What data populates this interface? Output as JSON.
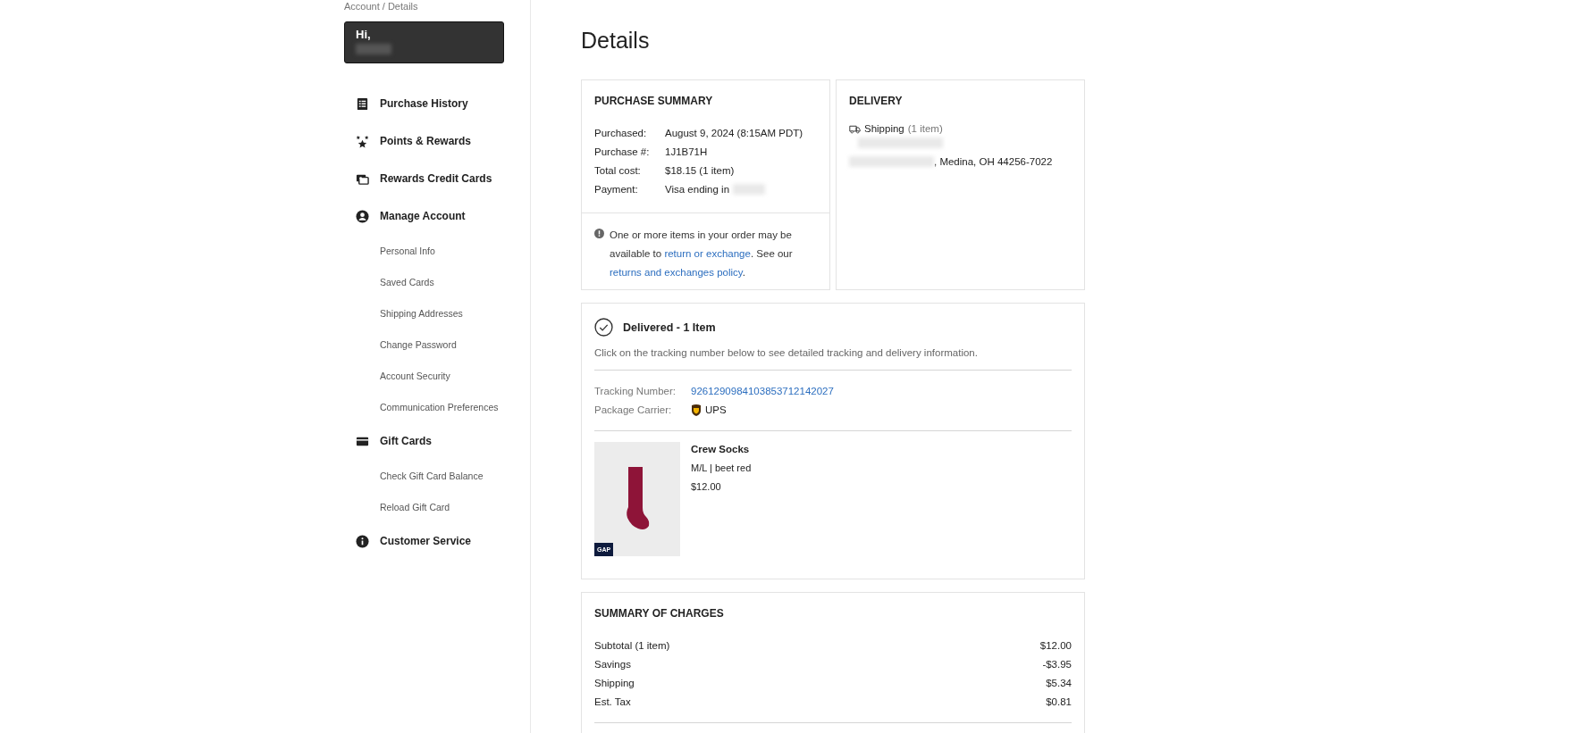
{
  "breadcrumb": "Account / Details",
  "greeting": "Hi,",
  "sidebar": {
    "items": [
      {
        "label": "Purchase History"
      },
      {
        "label": "Points & Rewards"
      },
      {
        "label": "Rewards Credit Cards"
      },
      {
        "label": "Manage Account",
        "children": [
          {
            "label": "Personal Info"
          },
          {
            "label": "Saved Cards"
          },
          {
            "label": "Shipping Addresses"
          },
          {
            "label": "Change Password"
          },
          {
            "label": "Account Security"
          },
          {
            "label": "Communication Preferences"
          }
        ]
      },
      {
        "label": "Gift Cards",
        "children": [
          {
            "label": "Check Gift Card Balance"
          },
          {
            "label": "Reload Gift Card"
          }
        ]
      },
      {
        "label": "Customer Service"
      }
    ]
  },
  "title": "Details",
  "purchase_summary": {
    "heading": "PURCHASE SUMMARY",
    "rows": [
      {
        "label": "Purchased:",
        "value": "August 9, 2024 (8:15AM PDT)"
      },
      {
        "label": "Purchase #:",
        "value": "1J1B71H"
      },
      {
        "label": "Total cost:",
        "value": "$18.15 (1 item)"
      },
      {
        "label": "Payment:",
        "value": "Visa ending in"
      }
    ],
    "notice": {
      "before": "One or more items in your order may be available to ",
      "link1": "return or exchange",
      "middle": ". See our ",
      "link2": "returns and exchanges policy",
      "after": "."
    }
  },
  "delivery": {
    "heading": "DELIVERY",
    "method": "Shipping",
    "count": "(1 item)",
    "address_tail": ", Medina, OH 44256-7022"
  },
  "shipment": {
    "status": "Delivered - 1 Item",
    "hint": "Click on the tracking number below to see detailed tracking and delivery information.",
    "tracking_label": "Tracking Number:",
    "tracking_number": "9261290984103853712142027",
    "carrier_label": "Package Carrier:",
    "carrier": "UPS",
    "items": [
      {
        "name": "Crew Socks",
        "variant": "M/L | beet red",
        "price": "$12.00",
        "brand": "GAP"
      }
    ]
  },
  "charges": {
    "heading": "SUMMARY OF CHARGES",
    "rows": [
      {
        "label": "Subtotal (1 item)",
        "amount": "$12.00"
      },
      {
        "label": "Savings",
        "amount": "-$3.95"
      },
      {
        "label": "Shipping",
        "amount": "$5.34"
      },
      {
        "label": "Est. Tax",
        "amount": "$0.81"
      }
    ]
  }
}
